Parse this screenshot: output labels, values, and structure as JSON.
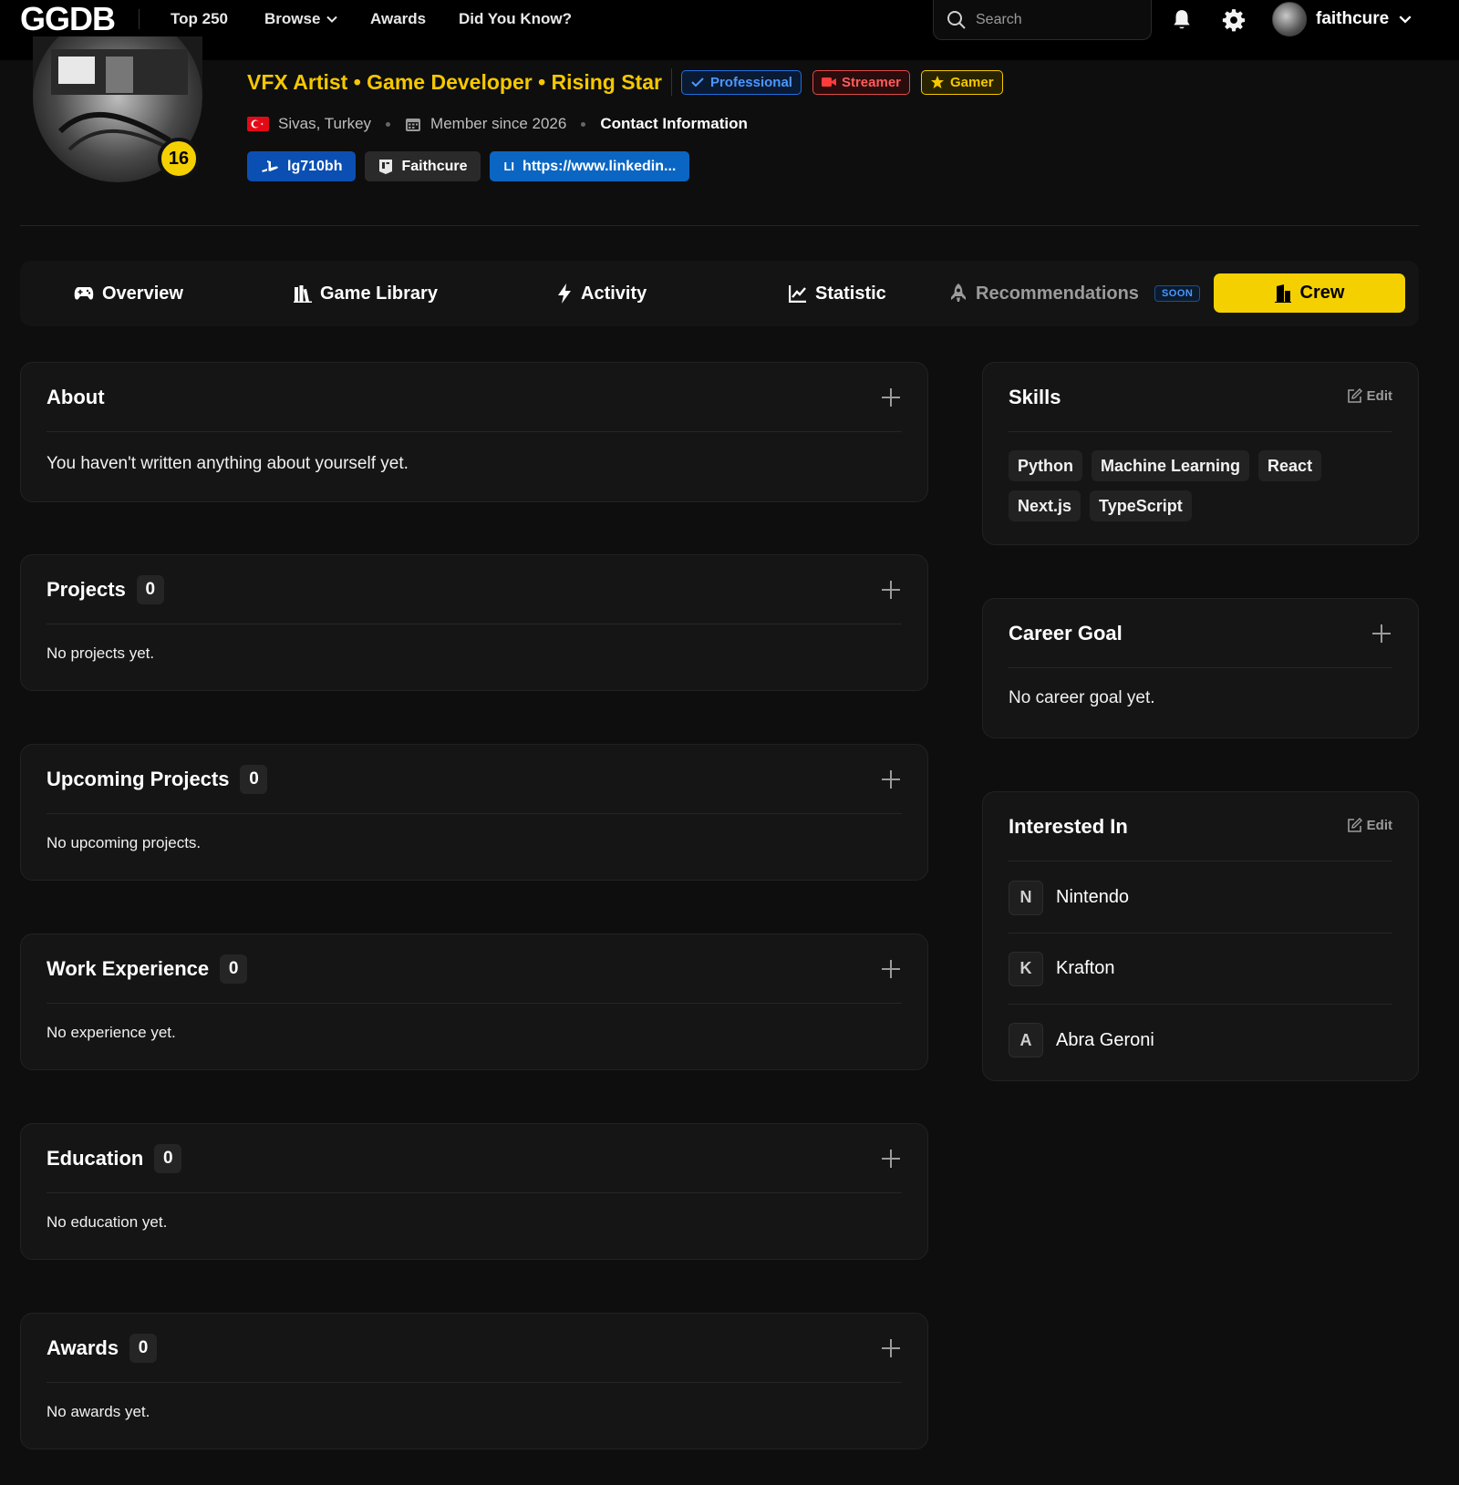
{
  "topbar": {
    "logo": "GGDB",
    "nav": [
      "Top 250",
      "Browse",
      "Awards",
      "Did You Know?"
    ],
    "search_placeholder": "Search",
    "username": "faithcure"
  },
  "profile": {
    "level": "16",
    "roles": "VFX Artist • Game Developer • Rising Star",
    "badges": [
      "Professional",
      "Streamer",
      "Gamer"
    ],
    "location": "Sivas, Turkey",
    "member_since": "Member since 2026",
    "contact": "Contact Information",
    "links": [
      "lg710bh",
      "Faithcure",
      "https://www.linkedin..."
    ],
    "linkedin_abbr": "LI"
  },
  "tabs": {
    "items": [
      "Overview",
      "Game Library",
      "Activity",
      "Statistic",
      "Recommendations"
    ],
    "soon": "SOON",
    "crew": "Crew"
  },
  "cards": {
    "about": {
      "title": "About",
      "empty": "You haven't written anything about yourself yet."
    },
    "projects": {
      "title": "Projects",
      "count": "0",
      "empty": "No projects yet."
    },
    "upcoming": {
      "title": "Upcoming Projects",
      "count": "0",
      "empty": "No upcoming projects."
    },
    "work": {
      "title": "Work Experience",
      "count": "0",
      "empty": "No experience yet."
    },
    "education": {
      "title": "Education",
      "count": "0",
      "empty": "No education yet."
    },
    "awards": {
      "title": "Awards",
      "count": "0",
      "empty": "No awards yet."
    },
    "skills": {
      "title": "Skills",
      "edit": "Edit",
      "items": [
        "Python",
        "Machine Learning",
        "React",
        "Next.js",
        "TypeScript"
      ]
    },
    "career": {
      "title": "Career Goal",
      "empty": "No career goal yet."
    },
    "interests": {
      "title": "Interested In",
      "edit": "Edit",
      "items": [
        {
          "letter": "N",
          "name": "Nintendo"
        },
        {
          "letter": "K",
          "name": "Krafton"
        },
        {
          "letter": "A",
          "name": "Abra Geroni"
        }
      ]
    }
  },
  "colors": {
    "accent": "#f5d000",
    "background": "#0e0e0e",
    "card": "#151515",
    "professional": "#4b98ff",
    "streamer": "#ff5c5c"
  }
}
